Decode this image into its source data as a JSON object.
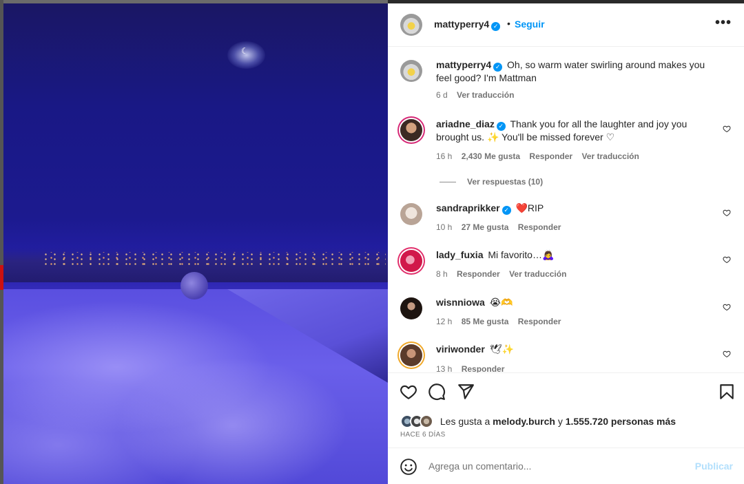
{
  "post": {
    "author": "mattyperry4",
    "dot": "•",
    "follow_label": "Seguir",
    "more_icon": "•••",
    "caption_user": "mattyperry4",
    "caption_text": "Oh, so warm water swirling around makes you feel good? I'm Mattman",
    "caption_time": "6 d",
    "caption_translate": "Ver traducción"
  },
  "comments": [
    {
      "user": "ariadne_diaz",
      "verified": true,
      "text": "Thank you for all the laughter and joy you brought us. ✨ You'll be missed forever ♡",
      "time": "16 h",
      "likes": "2,430 Me gusta",
      "reply": "Responder",
      "translate": "Ver traducción"
    },
    {
      "user": "sandraprikker",
      "verified": true,
      "text": "❤️RIP",
      "time": "10 h",
      "likes": "27 Me gusta",
      "reply": "Responder"
    },
    {
      "user": "lady_fuxia",
      "verified": false,
      "text": "Mi favorito…🙇‍♀️",
      "time": "8 h",
      "reply": "Responder",
      "translate": "Ver traducción"
    },
    {
      "user": "wisnniowa",
      "verified": false,
      "text": "😭🫶",
      "time": "12 h",
      "likes": "85 Me gusta",
      "reply": "Responder"
    },
    {
      "user": "viriwonder",
      "verified": false,
      "text": "🕊✨",
      "time": "13 h",
      "reply": "Responder"
    }
  ],
  "view_replies": "Ver respuestas (10)",
  "likes_summary": {
    "prefix": "Les gusta a",
    "user": "melody.burch",
    "conj": "y",
    "others": "1.555.720 personas más"
  },
  "posted_ago": "HACE 6 DÍAS",
  "composer": {
    "placeholder": "Agrega un comentario...",
    "publish": "Publicar"
  },
  "colors": {
    "accent": "#0095f6",
    "publish_disabled": "#b2dffc",
    "muted": "#737373"
  }
}
